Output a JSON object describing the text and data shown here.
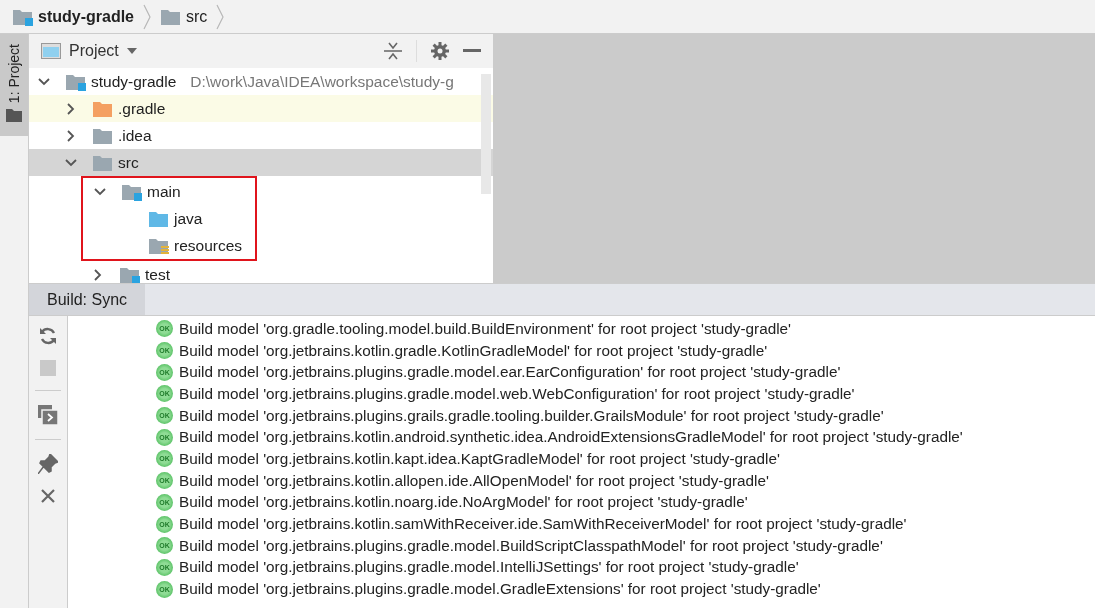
{
  "breadcrumbs": [
    {
      "label": "study-gradle",
      "kind": "module"
    },
    {
      "label": "src",
      "kind": "plain"
    }
  ],
  "side_tabs": [
    {
      "label": "1: Project",
      "selected": true
    }
  ],
  "project_panel": {
    "title": "Project",
    "tree": [
      {
        "label": "study-gradle",
        "kind": "module",
        "path": "D:\\work\\Java\\IDEA\\workspace\\study-g",
        "expanded": true,
        "selected": false,
        "ignored": false,
        "highlighted": false,
        "children": [
          {
            "label": ".gradle",
            "kind": "excluded",
            "expanded": false,
            "selected": false,
            "ignored": true,
            "highlighted": false
          },
          {
            "label": ".idea",
            "kind": "plain",
            "expanded": false,
            "selected": false,
            "ignored": false,
            "highlighted": false
          },
          {
            "label": "src",
            "kind": "plain",
            "expanded": true,
            "selected": true,
            "ignored": false,
            "highlighted": false,
            "children": [
              {
                "label": "main",
                "kind": "module",
                "expanded": true,
                "selected": false,
                "ignored": false,
                "highlighted": true,
                "children": [
                  {
                    "label": "java",
                    "kind": "source",
                    "selected": false,
                    "ignored": false
                  },
                  {
                    "label": "resources",
                    "kind": "resources",
                    "selected": false,
                    "ignored": false
                  }
                ]
              },
              {
                "label": "test",
                "kind": "module",
                "expanded": false,
                "selected": false,
                "ignored": false,
                "highlighted": false
              }
            ]
          }
        ]
      }
    ]
  },
  "build_panel": {
    "tabs": [
      {
        "label": "Build: Sync",
        "selected": true
      }
    ],
    "log": [
      {
        "status": "OK",
        "text": "Build model 'org.gradle.tooling.model.build.BuildEnvironment' for root project 'study-gradle'"
      },
      {
        "status": "OK",
        "text": "Build model 'org.jetbrains.kotlin.gradle.KotlinGradleModel' for root project 'study-gradle'"
      },
      {
        "status": "OK",
        "text": "Build model 'org.jetbrains.plugins.gradle.model.ear.EarConfiguration' for root project 'study-gradle'"
      },
      {
        "status": "OK",
        "text": "Build model 'org.jetbrains.plugins.gradle.model.web.WebConfiguration' for root project 'study-gradle'"
      },
      {
        "status": "OK",
        "text": "Build model 'org.jetbrains.plugins.grails.gradle.tooling.builder.GrailsModule' for root project 'study-gradle'"
      },
      {
        "status": "OK",
        "text": "Build model 'org.jetbrains.kotlin.android.synthetic.idea.AndroidExtensionsGradleModel' for root project 'study-gradle'"
      },
      {
        "status": "OK",
        "text": "Build model 'org.jetbrains.kotlin.kapt.idea.KaptGradleModel' for root project 'study-gradle'"
      },
      {
        "status": "OK",
        "text": "Build model 'org.jetbrains.kotlin.allopen.ide.AllOpenModel' for root project 'study-gradle'"
      },
      {
        "status": "OK",
        "text": "Build model 'org.jetbrains.kotlin.noarg.ide.NoArgModel' for root project 'study-gradle'"
      },
      {
        "status": "OK",
        "text": "Build model 'org.jetbrains.kotlin.samWithReceiver.ide.SamWithReceiverModel' for root project 'study-gradle'"
      },
      {
        "status": "OK",
        "text": "Build model 'org.jetbrains.plugins.gradle.model.BuildScriptClasspathModel' for root project 'study-gradle'"
      },
      {
        "status": "OK",
        "text": "Build model 'org.jetbrains.plugins.gradle.model.IntelliJSettings' for root project 'study-gradle'"
      },
      {
        "status": "OK",
        "text": "Build model 'org.jetbrains.plugins.gradle.model.GradleExtensions' for root project 'study-gradle'"
      }
    ]
  }
}
